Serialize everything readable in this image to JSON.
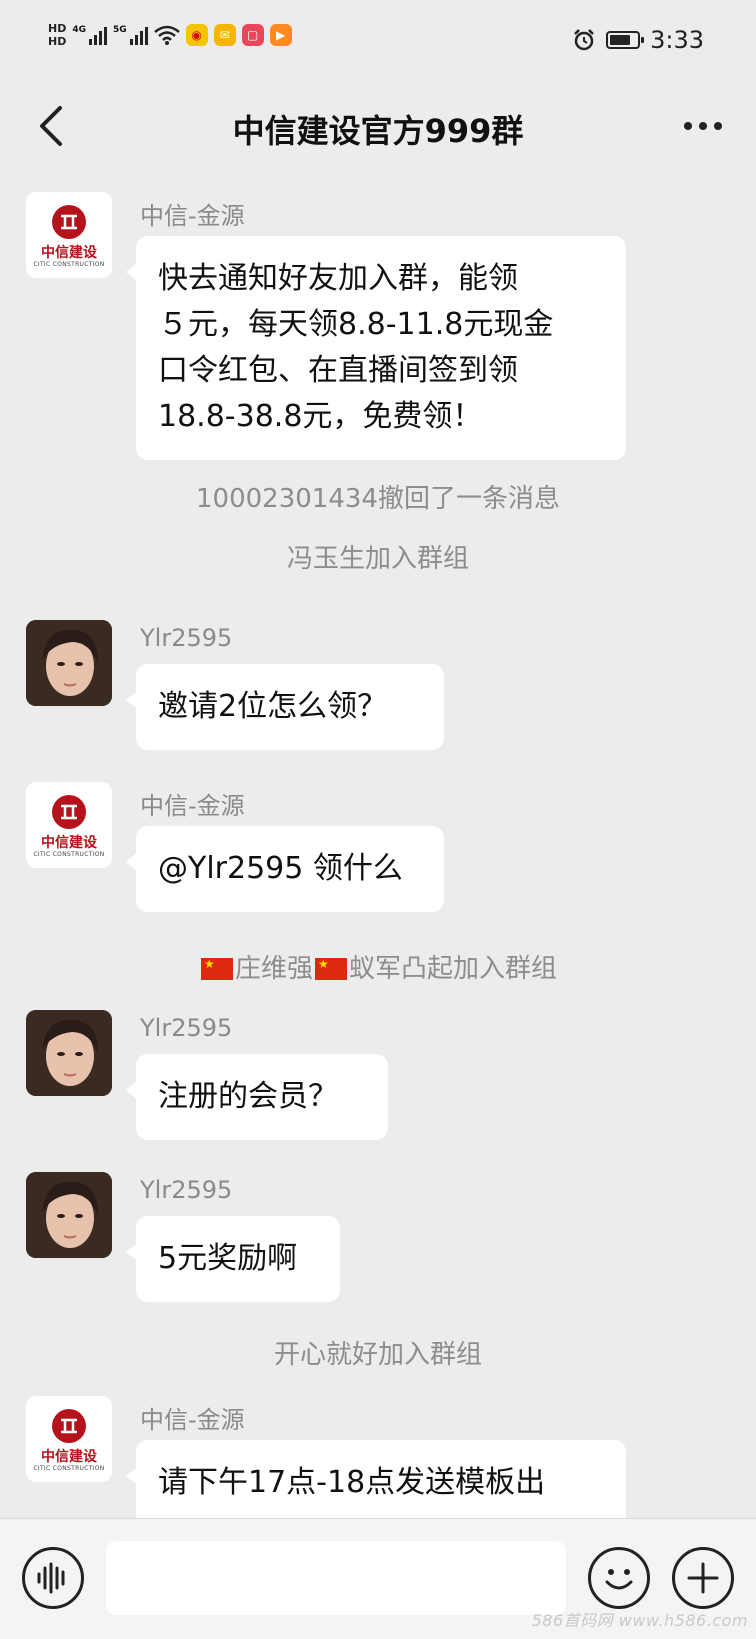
{
  "status_bar": {
    "hd1": "HD",
    "hd2": "HD",
    "network1": "4G",
    "network2": "5G",
    "time": "3:33",
    "app_icons": [
      "weibo-icon",
      "mail-icon",
      "red-app-icon",
      "video-icon"
    ],
    "battery_level": 0.75
  },
  "nav": {
    "title": "中信建设官方999群"
  },
  "messages": [
    {
      "type": "msg",
      "avatar": "citic",
      "sender": "中信-金源",
      "text": "快去通知好友加入群，能领\n５元，每天领8.8-11.8元现金\n口令红包、在直播间签到领\n18.8-38.8元，免费领！"
    },
    {
      "type": "sys",
      "text": "10002301434撤回了一条消息"
    },
    {
      "type": "sys",
      "text": "冯玉生加入群组"
    },
    {
      "type": "msg",
      "avatar": "person",
      "sender": "Ylr2595",
      "text": "邀请2位怎么领？"
    },
    {
      "type": "msg",
      "avatar": "citic",
      "sender": "中信-金源",
      "text": "@Ylr2595 领什么"
    },
    {
      "type": "sys",
      "text": "庄维强",
      "text2": "蚁军凸起加入群组"
    },
    {
      "type": "msg",
      "avatar": "person",
      "sender": "Ylr2595",
      "text": "注册的会员？"
    },
    {
      "type": "msg",
      "avatar": "person",
      "sender": "Ylr2595",
      "text": "5元奖励啊"
    },
    {
      "type": "sys",
      "text": "开心就好加入群组"
    },
    {
      "type": "msg",
      "avatar": "citic",
      "sender": "中信-金源",
      "text": "请下午17点-18点发送模板出"
    }
  ],
  "citic_logo": {
    "brand": "中信建设",
    "sub": "CITIC CONSTRUCTION"
  },
  "bottom": {
    "watermark": "586首码网 www.h586.com"
  },
  "colors": {
    "background": "#ececec",
    "citic_red": "#b5121b",
    "system_text": "#8d8d8d"
  }
}
